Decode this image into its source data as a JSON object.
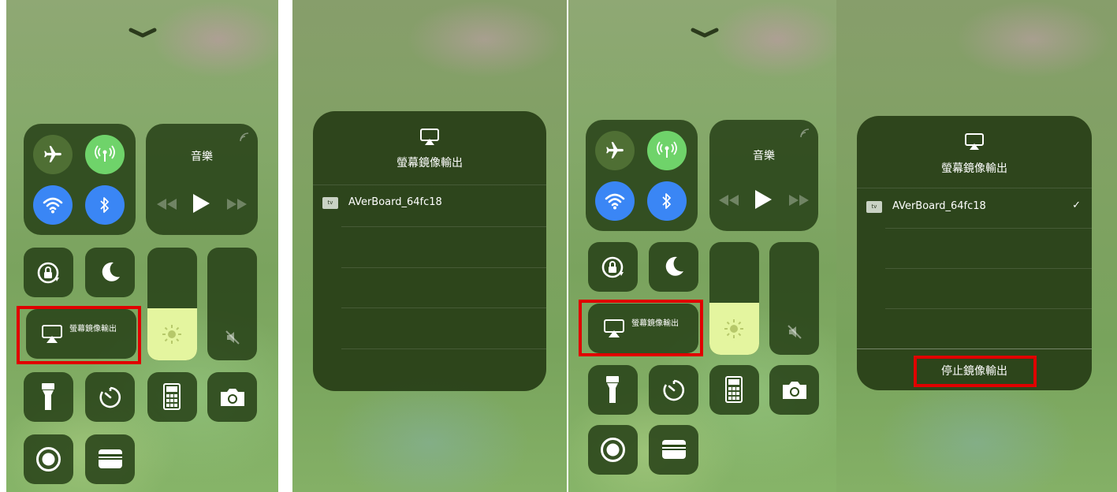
{
  "control_center": {
    "music_label": "音樂",
    "screen_mirroring_label": "螢幕鏡像輸出"
  },
  "airplay_dialog": {
    "title": "螢幕鏡像輸出",
    "device_badge": "tv",
    "device_name": "AVerBoard_64fc18",
    "selected_mark": "✓",
    "stop_button": "停止鏡像輸出"
  },
  "colors": {
    "highlight_red": "#e00000",
    "connectivity_green": "#6fd36a",
    "connectivity_blue": "#3a86f5",
    "brightness_fill": "#e4f59f"
  }
}
